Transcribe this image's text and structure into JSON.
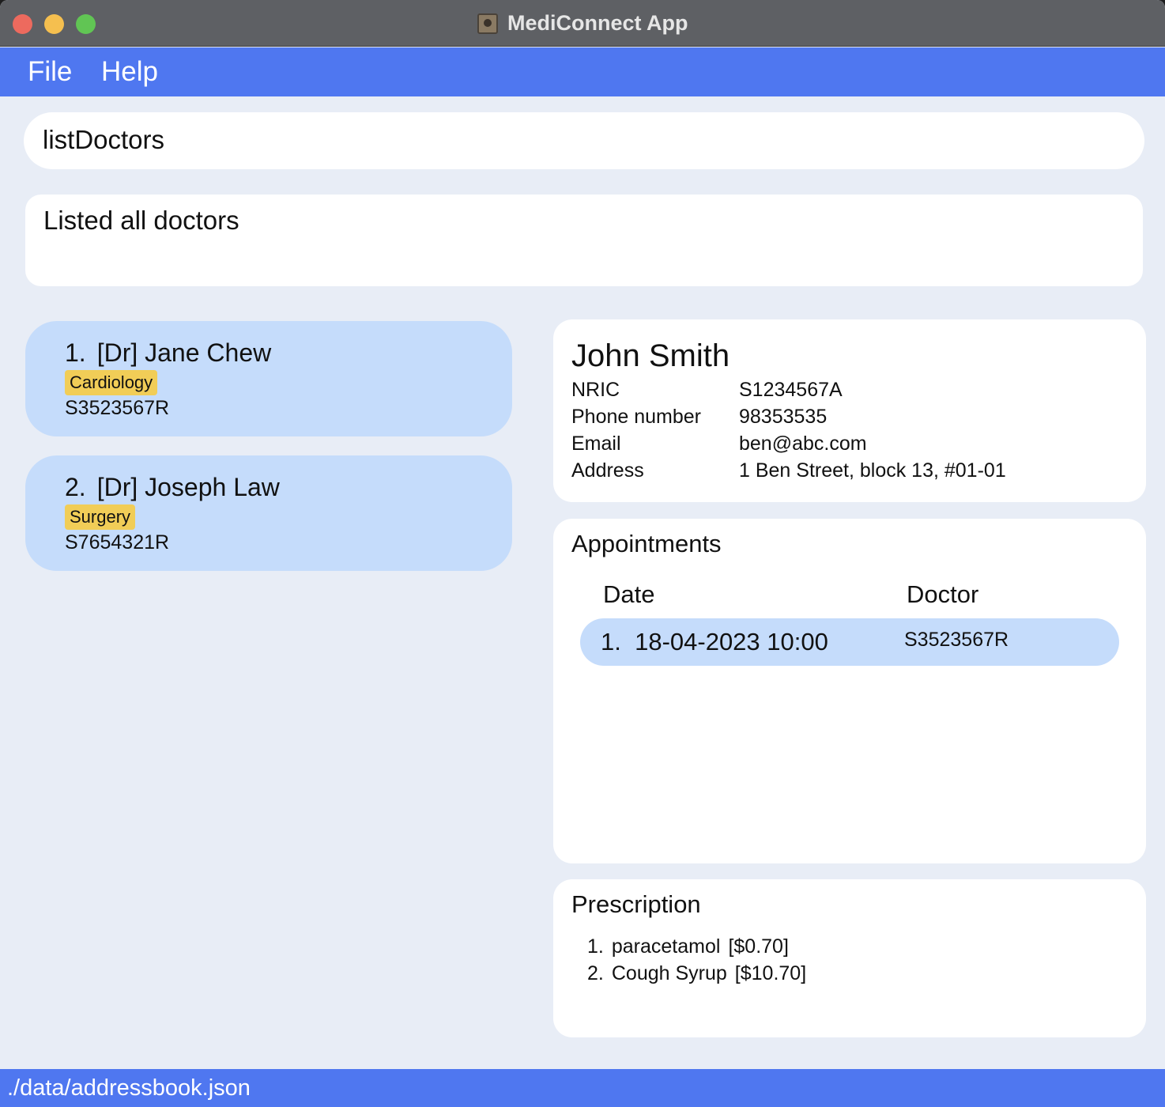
{
  "window": {
    "title": "MediConnect App"
  },
  "menu": {
    "file": "File",
    "help": "Help"
  },
  "command": {
    "value": "listDoctors"
  },
  "result": {
    "message": "Listed all doctors"
  },
  "doctors": [
    {
      "index": "1.",
      "name": "[Dr] Jane Chew",
      "specialty": "Cardiology",
      "nric": "S3523567R"
    },
    {
      "index": "2.",
      "name": "[Dr] Joseph Law",
      "specialty": "Surgery",
      "nric": "S7654321R"
    }
  ],
  "patient": {
    "name": "John Smith",
    "fields": [
      {
        "label": "NRIC",
        "value": "S1234567A"
      },
      {
        "label": "Phone number",
        "value": "98353535"
      },
      {
        "label": "Email",
        "value": "ben@abc.com"
      },
      {
        "label": "Address",
        "value": "1 Ben Street, block 13, #01-01"
      }
    ]
  },
  "appointments": {
    "title": "Appointments",
    "headers": {
      "date": "Date",
      "doctor": "Doctor"
    },
    "rows": [
      {
        "index": "1.",
        "datetime": "18-04-2023 10:00",
        "doctor": "S3523567R"
      }
    ]
  },
  "prescription": {
    "title": "Prescription",
    "items": [
      {
        "index": "1.",
        "name": "paracetamol",
        "price": "[$0.70]"
      },
      {
        "index": "2.",
        "name": "Cough Syrup",
        "price": "[$10.70]"
      }
    ]
  },
  "status": {
    "path": "./data/addressbook.json"
  },
  "colors": {
    "accent": "#4f77f0",
    "card": "#c5dcfb",
    "tag": "#f1cd57",
    "background": "#e8edf6"
  }
}
